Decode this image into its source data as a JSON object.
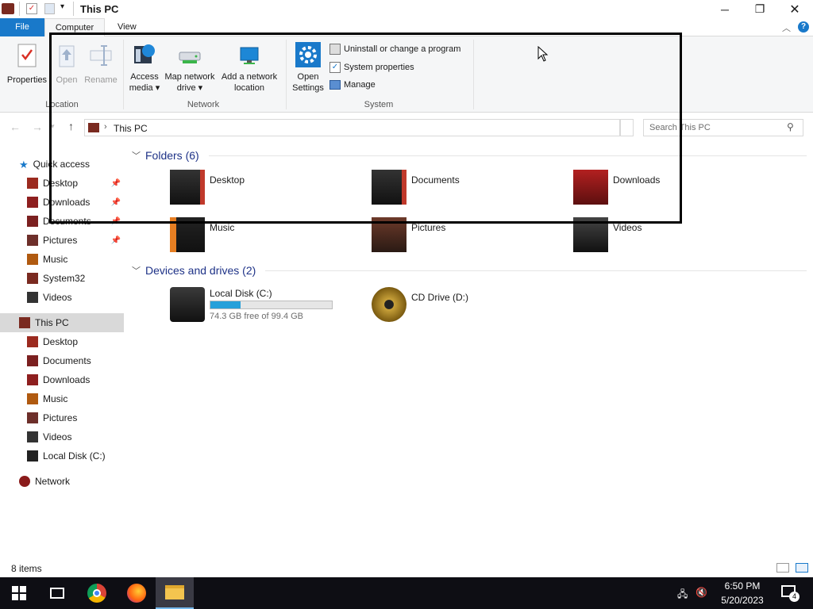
{
  "window": {
    "title": "This PC"
  },
  "ribbon_tabs": [
    {
      "label": "File"
    },
    {
      "label": "Computer"
    },
    {
      "label": "View"
    }
  ],
  "ribbon": {
    "location": {
      "title": "Location",
      "properties": "Properties",
      "open": "Open",
      "rename": "Rename"
    },
    "network": {
      "title": "Network",
      "access_media": [
        "Access",
        "media ▾"
      ],
      "map_drive": [
        "Map network",
        "drive ▾"
      ],
      "add_location": [
        "Add a network",
        "location"
      ]
    },
    "system": {
      "title": "System",
      "open_settings": [
        "Open",
        "Settings"
      ],
      "uninstall": "Uninstall or change a program",
      "system_properties": "System properties",
      "manage": "Manage"
    }
  },
  "address": {
    "path": "This PC",
    "search_placeholder": "Search This PC"
  },
  "nav": {
    "quick_access": "Quick access",
    "quick_items": [
      {
        "label": "Desktop",
        "pinned": true
      },
      {
        "label": "Downloads",
        "pinned": true
      },
      {
        "label": "Documents",
        "pinned": true
      },
      {
        "label": "Pictures",
        "pinned": true
      },
      {
        "label": "Music",
        "pinned": false
      },
      {
        "label": "System32",
        "pinned": false
      },
      {
        "label": "Videos",
        "pinned": false
      }
    ],
    "this_pc": "This PC",
    "pc_items": [
      "Desktop",
      "Documents",
      "Downloads",
      "Music",
      "Pictures",
      "Videos",
      "Local Disk (C:)"
    ],
    "network": "Network"
  },
  "content": {
    "folders_header": "Folders (6)",
    "folders": [
      "Desktop",
      "Documents",
      "Downloads",
      "Music",
      "Pictures",
      "Videos"
    ],
    "devices_header": "Devices and drives (2)",
    "drives": [
      {
        "name": "Local Disk (C:)",
        "free": "74.3 GB free of 99.4 GB",
        "used_fraction": 0.25
      },
      {
        "name": "CD Drive (D:)"
      }
    ]
  },
  "status": {
    "items": "8 items"
  },
  "taskbar": {
    "time": "6:50 PM",
    "date": "5/20/2023",
    "notifications": "4"
  },
  "colors": {
    "accent": "#1979ca",
    "bar_fill": "#26a0da",
    "header_text": "#1e3287"
  }
}
